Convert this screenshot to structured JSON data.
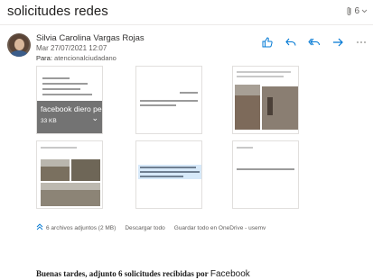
{
  "header": {
    "subject": "solicitudes redes",
    "attachment_count": "6"
  },
  "message": {
    "sender": "Silvia Carolina Vargas Rojas",
    "date": "Mar 27/07/2021 12:07",
    "to_label": "Para:",
    "to_value": "atencionalciudadano"
  },
  "attachments": {
    "hovered_name": "facebook diero perilla",
    "hovered_size": "33 KB",
    "summary": "6 archivos adjuntos (2 MB)",
    "download_all": "Descargar todo",
    "save_onedrive": "Guardar todo en OneDrive - usemv"
  },
  "body": {
    "text_bold": "Buenas tardes, adjunto 6 solicitudes recibidas por",
    "text_tail": "Facebook"
  },
  "icons": {
    "actions": [
      "like-icon",
      "reply-icon",
      "reply-all-icon",
      "forward-icon",
      "more-icon"
    ],
    "attachment": "paperclip-icon"
  },
  "colors": {
    "accent": "#0078d4",
    "highlight": "#d7e9f9"
  }
}
